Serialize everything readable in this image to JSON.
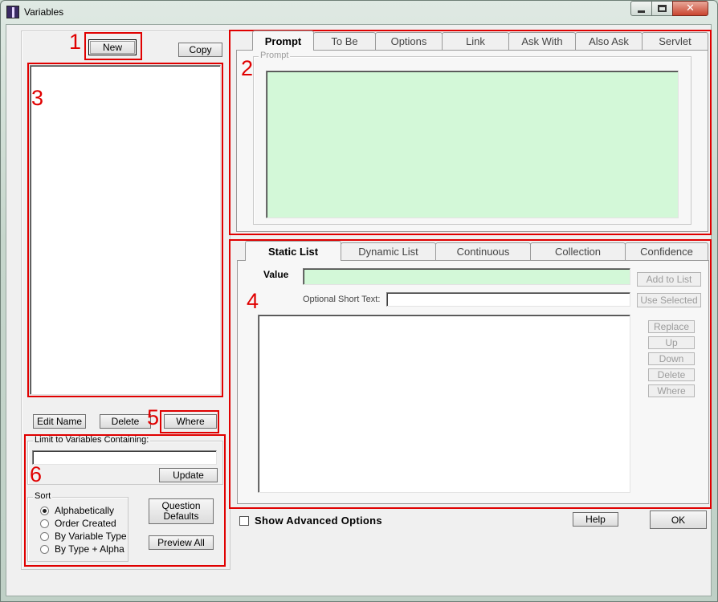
{
  "window": {
    "title": "Variables",
    "controls": {
      "minimize": "minimize",
      "maximize": "maximize",
      "close": "✕"
    }
  },
  "left_panel": {
    "new_label": "New",
    "copy_label": "Copy",
    "edit_name_label": "Edit Name",
    "delete_label": "Delete",
    "where_label": "Where",
    "limit_group_label": "Limit to Variables Containing:",
    "limit_input_value": "",
    "update_label": "Update",
    "sort_group_label": "Sort",
    "sort_options": [
      "Alphabetically",
      "Order Created",
      "By Variable Type",
      "By Type + Alpha"
    ],
    "sort_selected": "Alphabetically",
    "question_defaults_label": "Question\nDefaults",
    "preview_all_label": "Preview All"
  },
  "top_tabs": {
    "tabs": [
      "Prompt",
      "To Be",
      "Options",
      "Link",
      "Ask With",
      "Also Ask",
      "Servlet"
    ],
    "active": "Prompt",
    "prompt_group_label": "Prompt",
    "prompt_text": ""
  },
  "bottom_tabs": {
    "tabs": [
      "Static List",
      "Dynamic List",
      "Continuous",
      "Collection",
      "Confidence"
    ],
    "active": "Static List",
    "value_label": "Value",
    "value_text": "",
    "short_text_label": "Optional Short Text:",
    "short_text_value": "",
    "buttons": {
      "add_to_list": "Add to List",
      "use_selected": "Use Selected",
      "replace": "Replace",
      "up": "Up",
      "down": "Down",
      "delete": "Delete",
      "where": "Where"
    }
  },
  "footer": {
    "show_advanced_label": "Show Advanced Options",
    "show_advanced_checked": false,
    "help_label": "Help",
    "ok_label": "OK"
  },
  "annotations": [
    "1",
    "2",
    "3",
    "4",
    "5",
    "6"
  ],
  "colors": {
    "annotation": "#e00000",
    "input_green": "#d3f8d8"
  }
}
